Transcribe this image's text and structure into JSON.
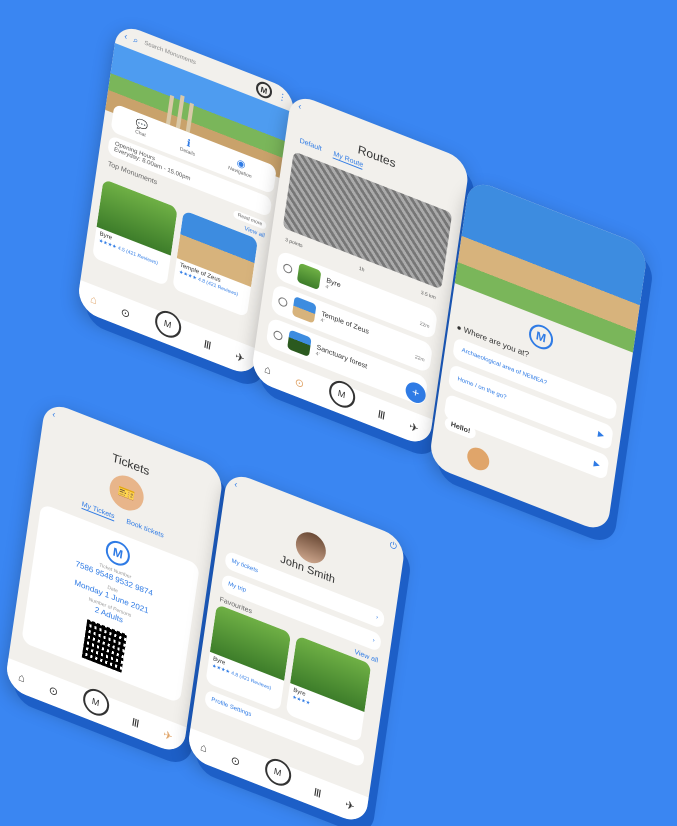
{
  "monuments": {
    "search_placeholder": "Search Monuments",
    "logo_letter": "M",
    "quick": [
      {
        "label": "Chat"
      },
      {
        "label": "Details"
      },
      {
        "label": "Navigation"
      }
    ],
    "hours_title": "Opening Hours",
    "hours_value": "Everyday: 8.00am - 15.00pm",
    "top_title": "Top Monuments",
    "read_more": "Read more",
    "view_all": "View all",
    "cards": [
      {
        "name": "Byre",
        "rating": "★★★★ 4.5 (421 Reviews)"
      },
      {
        "name": "Temple of Zeus",
        "rating": "★★★★ 4.8 (421 Reviews)"
      }
    ]
  },
  "routes": {
    "title": "Routes",
    "tab_default": "Default",
    "tab_my": "My Route",
    "meta_points": "3 points",
    "meta_duration": "1h",
    "meta_distance": "3.5 km",
    "items": [
      {
        "name": "Byre",
        "time": "4'",
        "dist": "22m"
      },
      {
        "name": "Temple of Zeus",
        "time": "4'",
        "dist": "22m"
      },
      {
        "name": "Sanctuary forest",
        "time": "4'",
        "dist": "22m"
      }
    ],
    "fab": "+"
  },
  "welcome": {
    "question": "Where are you at?",
    "opt1": "Archaeological area of NEMEA?",
    "opt2": "Home / on the go?",
    "hello": "Hello!"
  },
  "tickets": {
    "title": "Tickets",
    "tab_my": "My Tickets",
    "tab_book": "Book tickets",
    "ticket_number_label": "Ticket Number",
    "ticket_number": "7586 9548 9532 9874",
    "date_label": "Date",
    "date": "Monday 1 June 2021",
    "persons_label": "Number of Persons",
    "persons": "2 Adults"
  },
  "profile": {
    "name": "John Smith",
    "my_tickets": "My tickets",
    "my_trip": "My trip",
    "favourites": "Favourites",
    "view_all": "View all",
    "cards": [
      {
        "name": "Byre",
        "rating": "★★★★ 4.8 (421 Reviews)"
      },
      {
        "name": "Byre",
        "rating": "★★★★"
      }
    ],
    "settings": "Profile Settings"
  },
  "nav": {
    "home": "⌂",
    "map": "⊙",
    "center": "M",
    "temple": "Ⅲ",
    "route": "✈"
  }
}
